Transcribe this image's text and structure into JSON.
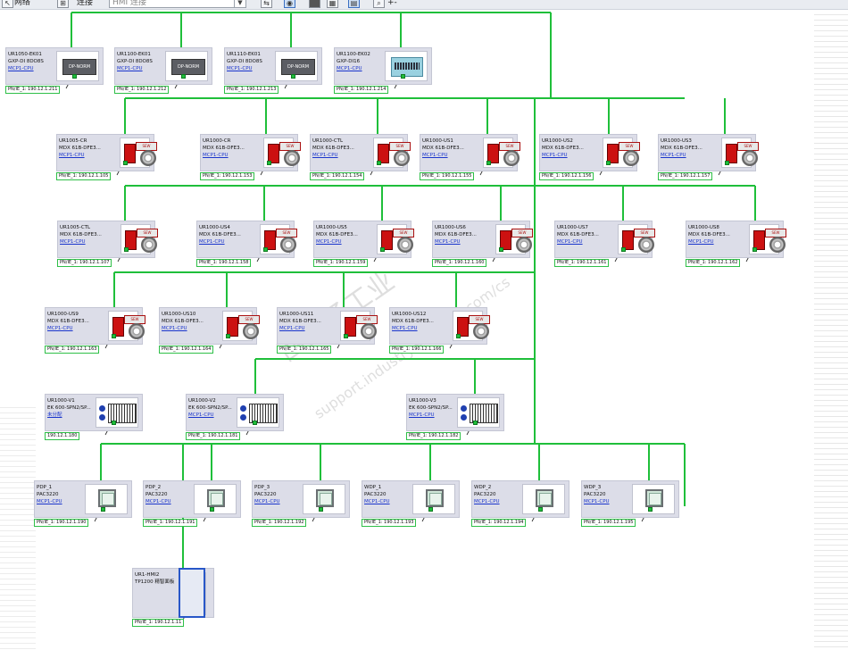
{
  "toolbar": {
    "network_label": "网络",
    "connection_label": "连接",
    "combo_value": "HMI 连接",
    "zoom_label": "+-"
  },
  "colors": {
    "bus": "#1fbf3a",
    "card_bg": "#dcdde8",
    "link": "#1a35cc",
    "select": "#2857c8"
  },
  "devices": [
    {
      "name": "UR1050-EK01",
      "type": "GXP-DI 8DO8S",
      "link": "MCP1-CPU",
      "ip": "PN/IE_1: 190.12.1.211",
      "icon": "dp-norm",
      "label": "DP-NORM"
    },
    {
      "name": "UR1100-EK01",
      "type": "GXP-DI 8DO8S",
      "link": "MCP1-CPU",
      "ip": "PN/IE_1: 190.12.1.212",
      "icon": "dp-norm",
      "label": "DP-NORM"
    },
    {
      "name": "UR1110-EK01",
      "type": "GXP-DI 8DO8S",
      "link": "MCP1-CPU",
      "ip": "PN/IE_1: 190.12.1.213",
      "icon": "dp-norm",
      "label": "DP-NORM"
    },
    {
      "name": "UR1100-EK02",
      "type": "GXP-DI16",
      "link": "MCP1-CPU",
      "ip": "PN/IE_1: 190.12.1.214",
      "icon": "et",
      "label": ""
    },
    {
      "name": "UR1005-CR",
      "type": "MDX 61B-DFE3...",
      "link": "MCP1-CPU",
      "ip": "PN/IE_1: 190.12.1.105",
      "icon": "mdx",
      "label": "SEW"
    },
    {
      "name": "UR1000-CR",
      "type": "MDX 61B-DFE3...",
      "link": "MCP1-CPU",
      "ip": "PN/IE_1: 190.12.1.153",
      "icon": "mdx",
      "label": "SEW"
    },
    {
      "name": "UR1000-CTL",
      "type": "MDX 61B-DFE3...",
      "link": "MCP1-CPU",
      "ip": "PN/IE_1: 190.12.1.154",
      "icon": "mdx",
      "label": "SEW"
    },
    {
      "name": "UR1000-US1",
      "type": "MDX 61B-DFE3...",
      "link": "MCP1-CPU",
      "ip": "PN/IE_1: 190.12.1.155",
      "icon": "mdx",
      "label": "SEW"
    },
    {
      "name": "UR1000-US2",
      "type": "MDX 61B-DFE3...",
      "link": "MCP1-CPU",
      "ip": "PN/IE_1: 190.12.1.156",
      "icon": "mdx",
      "label": "SEW"
    },
    {
      "name": "UR1000-US3",
      "type": "MDX 61B-DFE3...",
      "link": "MCP1-CPU",
      "ip": "PN/IE_1: 190.12.1.157",
      "icon": "mdx",
      "label": "SEW"
    },
    {
      "name": "UR1005-CTL",
      "type": "MDX 61B-DFE3...",
      "link": "MCP1-CPU",
      "ip": "PN/IE_1: 190.12.1.107",
      "icon": "mdx",
      "label": "SEW"
    },
    {
      "name": "UR1000-US4",
      "type": "MDX 61B-DFE3...",
      "link": "MCP1-CPU",
      "ip": "PN/IE_1: 190.12.1.158",
      "icon": "mdx",
      "label": "SEW"
    },
    {
      "name": "UR1000-US5",
      "type": "MDX 61B-DFE3...",
      "link": "MCP1-CPU",
      "ip": "PN/IE_1: 190.12.1.159",
      "icon": "mdx",
      "label": "SEW"
    },
    {
      "name": "UR1000-US6",
      "type": "MDX 61B-DFE3...",
      "link": "MCP1-CPU",
      "ip": "PN/IE_1: 190.12.1.160",
      "icon": "mdx",
      "label": "SEW"
    },
    {
      "name": "UR1000-US7",
      "type": "MDX 61B-DFE3...",
      "link": "MCP1-CPU",
      "ip": "PN/IE_1: 190.12.1.161",
      "icon": "mdx",
      "label": "SEW"
    },
    {
      "name": "UR1000-US8",
      "type": "MDX 61B-DFE3...",
      "link": "MCP1-CPU",
      "ip": "PN/IE_1: 190.12.1.162",
      "icon": "mdx",
      "label": "SEW"
    },
    {
      "name": "UR1000-US9",
      "type": "MDX 61B-DFE3...",
      "link": "MCP1-CPU",
      "ip": "PN/IE_1: 190.12.1.163",
      "icon": "mdx",
      "label": "SEW"
    },
    {
      "name": "UR1000-US10",
      "type": "MDX 61B-DFE3...",
      "link": "MCP1-CPU",
      "ip": "PN/IE_1: 190.12.1.164",
      "icon": "mdx",
      "label": "SEW"
    },
    {
      "name": "UR1000-US11",
      "type": "MDX 61B-DFE3...",
      "link": "MCP1-CPU",
      "ip": "PN/IE_1: 190.12.1.165",
      "icon": "mdx",
      "label": "SEW"
    },
    {
      "name": "UR1000-US12",
      "type": "MDX 61B-DFE3...",
      "link": "MCP1-CPU",
      "ip": "PN/IE_1: 190.12.1.166",
      "icon": "mdx",
      "label": "SEW"
    },
    {
      "name": "UR1000-V1",
      "type": "EK 600-SPN2/SP...",
      "link": "未分配",
      "ip": "190.12.1.180",
      "icon": "et200",
      "label": ""
    },
    {
      "name": "UR1000-V2",
      "type": "EK 600-SPN2/SP...",
      "link": "MCP1-CPU",
      "ip": "PN/IE_1: 190.12.1.181",
      "icon": "et200",
      "label": ""
    },
    {
      "name": "UR1000-V3",
      "type": "EK 600-SPN2/SP...",
      "link": "MCP1-CPU",
      "ip": "PN/IE_1: 190.12.1.182",
      "icon": "et200",
      "label": ""
    },
    {
      "name": "PDP_1",
      "type": "PAC3220",
      "link": "MCP1-CPU",
      "ip": "PN/IE_1: 190.12.1.190",
      "icon": "pac",
      "label": ""
    },
    {
      "name": "PDP_2",
      "type": "PAC3220",
      "link": "MCP1-CPU",
      "ip": "PN/IE_1: 190.12.1.191",
      "icon": "pac",
      "label": ""
    },
    {
      "name": "PDP_3",
      "type": "PAC3220",
      "link": "MCP1-CPU",
      "ip": "PN/IE_1: 190.12.1.192",
      "icon": "pac",
      "label": ""
    },
    {
      "name": "WDP_1",
      "type": "PAC3220",
      "link": "MCP1-CPU",
      "ip": "PN/IE_1: 190.12.1.193",
      "icon": "pac",
      "label": ""
    },
    {
      "name": "WDP_2",
      "type": "PAC3220",
      "link": "MCP1-CPU",
      "ip": "PN/IE_1: 190.12.1.194",
      "icon": "pac",
      "label": ""
    },
    {
      "name": "WDP_3",
      "type": "PAC3220",
      "link": "MCP1-CPU",
      "ip": "PN/IE_1: 190.12.1.195",
      "icon": "pac",
      "label": ""
    },
    {
      "name": "UR1-HMI2",
      "type": "TP1200 精智面板",
      "link": "",
      "ip": "PN/IE_1: 190.12.1.11",
      "icon": "hmi",
      "label": ""
    }
  ],
  "watermark": [
    "西门子工业",
    "support.industry.siemens.com/cs"
  ]
}
